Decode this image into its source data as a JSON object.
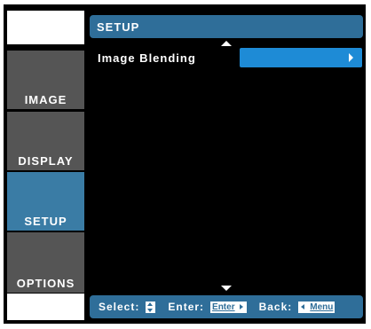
{
  "header": {
    "title": "SETUP"
  },
  "tabs": [
    {
      "label": "IMAGE",
      "active": false
    },
    {
      "label": "DISPLAY",
      "active": false
    },
    {
      "label": "SETUP",
      "active": true
    },
    {
      "label": "OPTIONS",
      "active": false
    }
  ],
  "menu": {
    "items": [
      {
        "label": "Image Blending",
        "value_icon": "right-arrow-icon"
      }
    ],
    "scroll_up_icon": "up-arrow-icon",
    "scroll_down_icon": "down-arrow-icon"
  },
  "footer": {
    "select_label": "Select:",
    "enter_label": "Enter:",
    "enter_key": "Enter",
    "back_label": "Back:",
    "menu_key": "Menu"
  },
  "colors": {
    "accent": "#2f6e99",
    "active_tab": "#3a7ca5",
    "highlight": "#1e8bd6",
    "inactive_tab": "#555555"
  }
}
